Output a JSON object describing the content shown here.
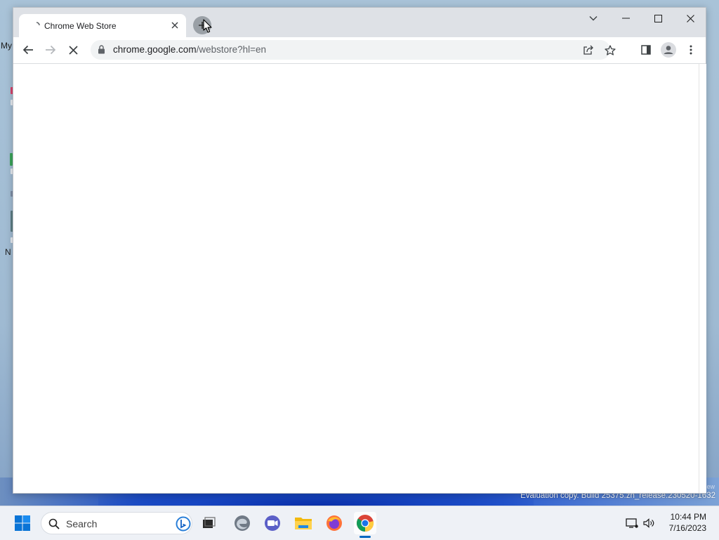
{
  "browser": {
    "tab": {
      "title": "Chrome Web Store"
    },
    "address": {
      "host": "chrome.google.com",
      "path": "/webstore?hl=en"
    }
  },
  "desktop": {
    "watermark_top": "ew",
    "watermark": "Evaluation copy. Build 25375.zn_release.230520-1632",
    "fragments": [
      "My",
      "N"
    ]
  },
  "taskbar": {
    "search_label": "Search",
    "time": "10:44 PM",
    "date": "7/16/2023",
    "apps": [
      "start-icon",
      "bing-icon",
      "task-view-icon",
      "edge-icon",
      "teams-icon",
      "file-explorer-icon",
      "firefox-icon",
      "chrome-icon"
    ]
  },
  "colors": {
    "tabstrip": "#dee1e6",
    "omnibox": "#f1f3f4",
    "accent": "#0067c0"
  }
}
